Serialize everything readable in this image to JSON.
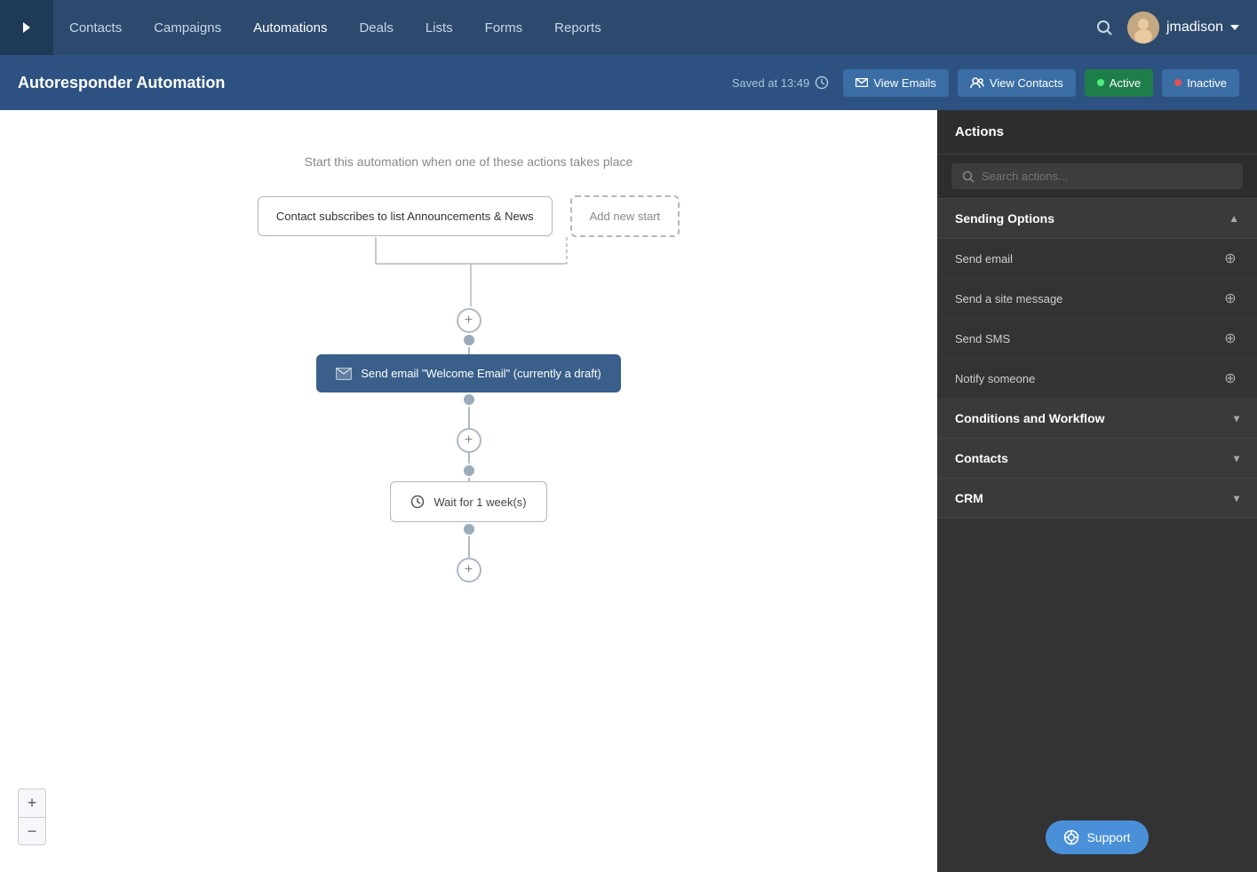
{
  "nav": {
    "toggle_label": "›",
    "items": [
      {
        "label": "Contacts",
        "active": false
      },
      {
        "label": "Campaigns",
        "active": false
      },
      {
        "label": "Automations",
        "active": true
      },
      {
        "label": "Deals",
        "active": false
      },
      {
        "label": "Lists",
        "active": false
      },
      {
        "label": "Forms",
        "active": false
      },
      {
        "label": "Reports",
        "active": false
      }
    ],
    "user": "jmadison"
  },
  "subheader": {
    "title": "Autoresponder Automation",
    "saved_text": "Saved at 13:49",
    "btn_view_emails": "View Emails",
    "btn_view_contacts": "View Contacts",
    "btn_active": "Active",
    "btn_inactive": "Inactive"
  },
  "canvas": {
    "start_text": "Start this automation when one of these actions takes place",
    "trigger_label": "Contact subscribes to list Announcements & News",
    "add_start_label": "Add new start",
    "action_node_label": "Send email \"Welcome Email\" (currently a draft)",
    "wait_node_label": "Wait for 1 week(s)"
  },
  "sidebar": {
    "title": "Actions",
    "search_placeholder": "Search actions...",
    "sections": [
      {
        "label": "Sending Options",
        "expanded": true,
        "items": [
          {
            "label": "Send email"
          },
          {
            "label": "Send a site message"
          },
          {
            "label": "Send SMS"
          },
          {
            "label": "Notify someone"
          }
        ]
      },
      {
        "label": "Conditions and Workflow",
        "expanded": false,
        "items": []
      },
      {
        "label": "Contacts",
        "expanded": false,
        "items": []
      },
      {
        "label": "CRM",
        "expanded": false,
        "items": []
      }
    ],
    "support_label": "Support"
  },
  "zoom": {
    "plus_label": "+",
    "minus_label": "−"
  }
}
